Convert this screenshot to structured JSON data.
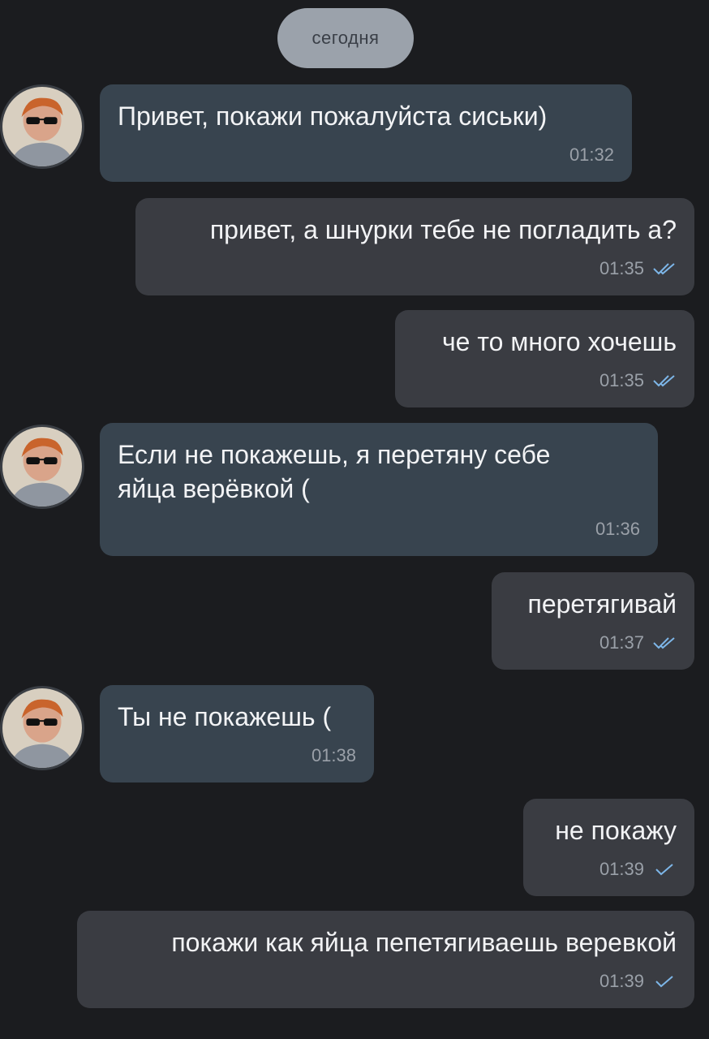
{
  "date_separator": "сегодня",
  "colors": {
    "background": "#1b1c1f",
    "incoming_bubble": "#38444f",
    "outgoing_bubble": "#3a3c42",
    "check_read": "#7db6e8",
    "date_pill": "#9ba2ab"
  },
  "messages": [
    {
      "text": "Привет, покажи пожалуйста сиськи)",
      "time": "01:32"
    },
    {
      "text": "привет, а шнурки тебе не погладить а?",
      "time": "01:35",
      "status_icon": "double-check-icon"
    },
    {
      "text": "че то много хочешь",
      "time": "01:35",
      "status_icon": "double-check-icon"
    },
    {
      "text_line1": "Если не покажешь, я перетяну себе",
      "text_line2": "яйца верёвкой (",
      "time": "01:36"
    },
    {
      "text": "перетягивай",
      "time": "01:37",
      "status_icon": "double-check-icon"
    },
    {
      "text": "Ты не покажешь (",
      "time": "01:38"
    },
    {
      "text": "не покажу",
      "time": "01:39",
      "status_icon": "single-check-icon"
    },
    {
      "text": "покажи как яйца пепетягиваешь веревкой",
      "time": "01:39",
      "status_icon": "single-check-icon"
    }
  ]
}
